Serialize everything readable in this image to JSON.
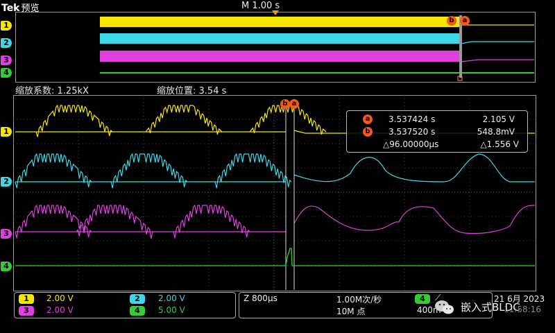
{
  "header": {
    "brand": "Tek",
    "mode": "预览",
    "horizontal_scale": "M 1.00 s"
  },
  "overview": {
    "cursor_b_label": "b",
    "cursor_a_label": "a"
  },
  "zoom_info": {
    "factor_label": "缩放系数:",
    "factor_value": "1.25kX",
    "position_label": "缩放位置:",
    "position_value": "3.54 s"
  },
  "channels": [
    {
      "id": "1",
      "color": "#f5e600"
    },
    {
      "id": "2",
      "color": "#3cd8e8"
    },
    {
      "id": "3",
      "color": "#e040e0"
    },
    {
      "id": "4",
      "color": "#33cc33"
    }
  ],
  "measurement": {
    "a_time": "3.537424 s",
    "a_value": "2.105 V",
    "b_time": "3.537520 s",
    "b_value": "548.8mV",
    "delta_time": "△96.00000µs",
    "delta_value": "△1.556 V"
  },
  "status": {
    "ch1_scale": "2.00 V",
    "ch2_scale": "2.00 V",
    "ch3_scale": "2.00 V",
    "ch4_scale": "5.00 V",
    "zoom_timebase": "Z 800µs",
    "sample_rate": "1.00M次/秒",
    "record_length": "10M 点",
    "trigger_channel": "4",
    "trigger_level": "400m",
    "date": "21 6月 2023",
    "time": "11:58:16",
    "watermark": "嵌入式BLDC"
  }
}
